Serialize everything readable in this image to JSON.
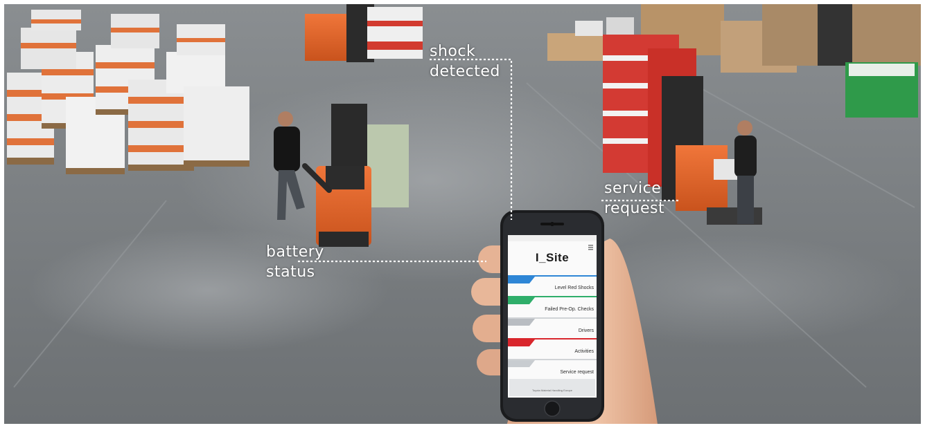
{
  "callouts": {
    "shock": [
      "shock",
      "detected"
    ],
    "service": [
      "service",
      "request"
    ],
    "battery": [
      "battery",
      "status"
    ]
  },
  "phone": {
    "app_title": "I_Site",
    "menu": [
      {
        "label": "Level Red Shocks",
        "color": "#2e86d6"
      },
      {
        "label": "Failed Pre-Op. Checks",
        "color": "#2fae6a"
      },
      {
        "label": "Drivers",
        "color": "#b9bdc2"
      },
      {
        "label": "Activities",
        "color": "#d9262c"
      },
      {
        "label": "Service request",
        "color": "#c8ccd0"
      }
    ],
    "footer": "Toyota Material Handling Europe"
  },
  "colors": {
    "forklift_orange": "#e8662a",
    "floor": "#7d8184",
    "callout_line": "#ffffff"
  }
}
